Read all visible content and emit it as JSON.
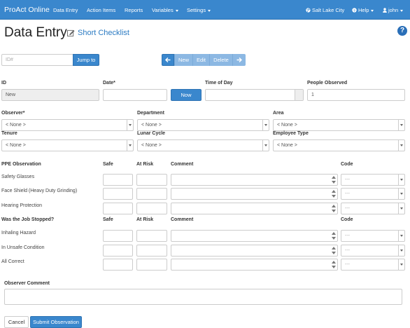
{
  "navbar": {
    "brand": "ProAct Online",
    "items": [
      "Data Entry",
      "Action Items",
      "Reports",
      "Variables",
      "Settings"
    ],
    "location": "Salt Lake City",
    "help": "Help",
    "user": "john"
  },
  "header": {
    "title": "Data Entry",
    "subtitle": "Short Checklist",
    "help_icon": "?"
  },
  "lookup": {
    "id_placeholder": "ID#",
    "jump_label": "Jump to"
  },
  "toolbar": {
    "new_label": "New",
    "edit_label": "Edit",
    "delete_label": "Delete",
    "prev_icon": "arrow-left-icon",
    "next_icon": "arrow-right-icon"
  },
  "fields": {
    "id_label": "ID",
    "id_value": "New",
    "date_label": "Date*",
    "now_label": "Now",
    "time_label": "Time of Day",
    "people_label": "People Observed",
    "people_value": "1",
    "observer_label": "Observer*",
    "observer_value": "< None >",
    "department_label": "Department",
    "department_value": "< None >",
    "area_label": "Area",
    "area_value": "< None >",
    "tenure_label": "Tenure",
    "tenure_value": "< None >",
    "lunar_label": "Lunar Cycle",
    "lunar_value": "< None >",
    "employee_type_label": "Employee Type",
    "employee_type_value": "< None >"
  },
  "sections": [
    {
      "title": "PPE Observation",
      "safe": "Safe",
      "at_risk": "At Risk",
      "comment": "Comment",
      "code": "Code",
      "rows": [
        {
          "label": "Safety Glasses",
          "code": "---"
        },
        {
          "label": "Face Shield (Heavy Duty Grinding)",
          "code": "---"
        },
        {
          "label": "Hearing Protection",
          "code": "---"
        }
      ]
    },
    {
      "title": "Was the Job Stopped?",
      "safe": "Safe",
      "at_risk": "At Risk",
      "comment": "Comment",
      "code": "Code",
      "rows": [
        {
          "label": "Inhaling Hazard",
          "code": "---"
        },
        {
          "label": "In Unsafe Condition",
          "code": "---"
        },
        {
          "label": "All Correct",
          "code": "---"
        }
      ]
    }
  ],
  "observer_comment": {
    "label": "Observer Comment"
  },
  "footer": {
    "cancel_label": "Cancel",
    "submit_label": "Submit Observation"
  },
  "colors": {
    "primary": "#3a87cd",
    "primary_light": "#8cb8e3",
    "link": "#2a7ac2"
  }
}
